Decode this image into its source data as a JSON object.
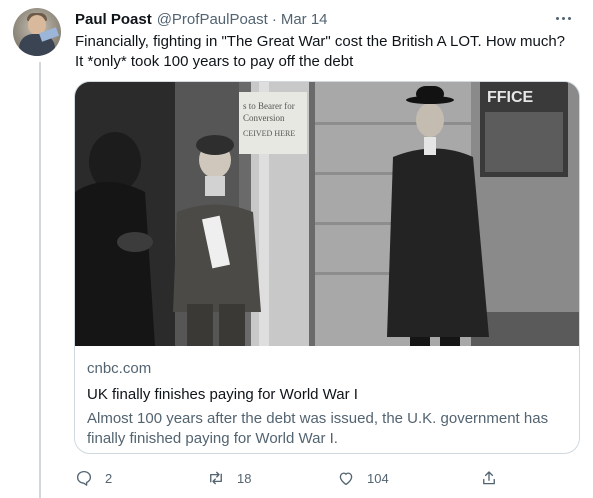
{
  "tweet": {
    "display_name": "Paul Poast",
    "handle": "@ProfPaulPoast",
    "separator": "·",
    "date": "Mar 14",
    "text_line1": "Financially, fighting in \"The Great War\" cost the British A LOT. How much?",
    "text_line2": "It *only* took 100 years to pay off the debt"
  },
  "card": {
    "photo_sign_line1": "s to Bearer for",
    "photo_sign_line2": "Conversion",
    "photo_sign_line3": "CEIVED HERE",
    "photo_office_text": "FFICE",
    "domain": "cnbc.com",
    "title": "UK finally finishes paying for World War I",
    "description": "Almost 100 years after the debt was issued, the U.K. government has finally finished paying for World War I."
  },
  "actions": {
    "replies": "2",
    "retweets": "18",
    "likes": "104"
  },
  "colors": {
    "text_primary": "#0f1419",
    "text_secondary": "#536471",
    "border": "#cfd9de"
  },
  "icons": [
    "more-icon",
    "reply-icon",
    "retweet-icon",
    "like-icon",
    "share-icon"
  ]
}
